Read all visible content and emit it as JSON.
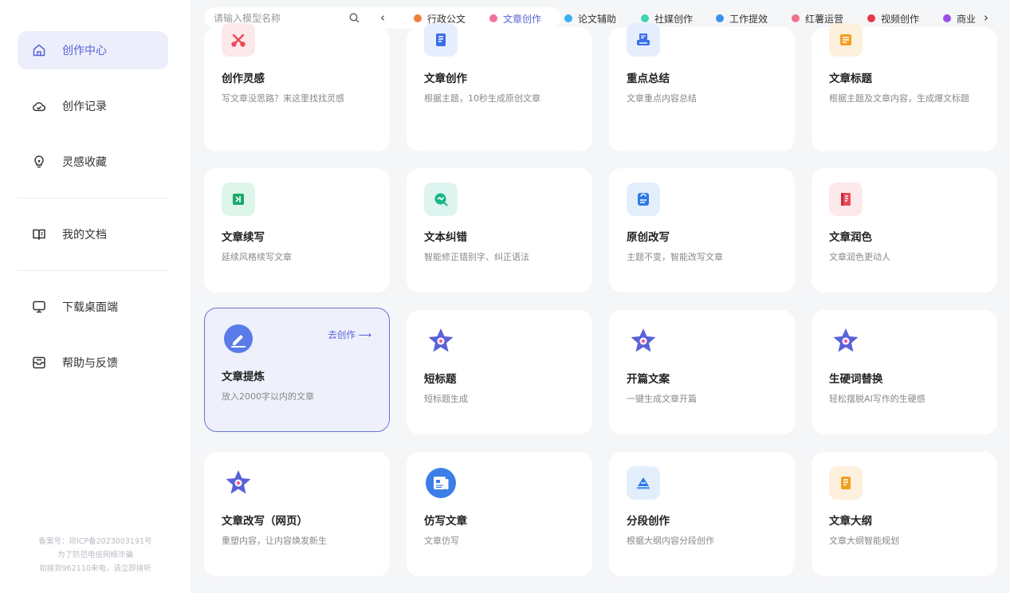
{
  "sidebar": {
    "items": [
      {
        "label": "创作中心",
        "icon": "home-icon",
        "active": true
      },
      {
        "label": "创作记录",
        "icon": "cloud-icon"
      },
      {
        "label": "灵感收藏",
        "icon": "lightbulb-icon"
      },
      {
        "label": "我的文档",
        "icon": "book-icon"
      },
      {
        "label": "下载桌面端",
        "icon": "monitor-icon"
      },
      {
        "label": "帮助与反馈",
        "icon": "mailbox-icon"
      }
    ],
    "footer": {
      "line1": "备案号：琼ICP备2023003191号",
      "line2": "为了防范电信网络诈骗",
      "line3": "如接到962110来电，请立即接听"
    }
  },
  "search": {
    "placeholder": "请输入模型名称"
  },
  "categories": [
    {
      "label": "行政公文",
      "color": "#f07f3c"
    },
    {
      "label": "文章创作",
      "color": "#f0719a",
      "active": true
    },
    {
      "label": "论文辅助",
      "color": "#3ab0ef"
    },
    {
      "label": "社媒创作",
      "color": "#3fd3b0"
    },
    {
      "label": "工作提效",
      "color": "#3d8ef0"
    },
    {
      "label": "红薯运营",
      "color": "#f0718a"
    },
    {
      "label": "视频创作",
      "color": "#e8374a"
    },
    {
      "label": "商业",
      "color": "#9a4ee8"
    }
  ],
  "goto_label": "去创作 ⟶",
  "cards": [
    {
      "title": "创作灵感",
      "desc": "写文章没思路？来这里找找灵感",
      "icon": "scissors-icon",
      "bg": "#fde8ea",
      "fg": "#e94a5a"
    },
    {
      "title": "文章创作",
      "desc": "根据主题，10秒生成原创文章",
      "icon": "document-icon",
      "bg": "#e6eefd",
      "fg": "#3b6ee8"
    },
    {
      "title": "重点总结",
      "desc": "文章重点内容总结",
      "icon": "printer-icon",
      "bg": "#e6eefd",
      "fg": "#3b6ee8"
    },
    {
      "title": "文章标题",
      "desc": "根据主题及文章内容，生成爆文标题",
      "icon": "title-card-icon",
      "bg": "#fdf0dd",
      "fg": "#f0a020"
    },
    {
      "title": "文章续写",
      "desc": "延续风格续写文章",
      "icon": "continue-book-icon",
      "bg": "#def5ea",
      "fg": "#1aa86a"
    },
    {
      "title": "文本纠错",
      "desc": "智能修正错别字、纠正语法",
      "icon": "check-search-icon",
      "bg": "#def5ef",
      "fg": "#1ab48a"
    },
    {
      "title": "原创改写",
      "desc": "主题不变，智能改写文章",
      "icon": "rewrite-doc-icon",
      "bg": "#e3eefd",
      "fg": "#2d7ae8"
    },
    {
      "title": "文章润色",
      "desc": "文章润色更动人",
      "icon": "polish-book-icon",
      "bg": "#fde8ea",
      "fg": "#e94a5a"
    },
    {
      "title": "文章提炼",
      "desc": "放入2000字以内的文章",
      "icon": "edit-circle-icon",
      "bg": "#5a7be8",
      "fg": "#ffffff",
      "highlight": true
    },
    {
      "title": "短标题",
      "desc": "短标题生成",
      "icon": "star-icon",
      "bg": "transparent",
      "fg": "#5a62d8"
    },
    {
      "title": "开篇文案",
      "desc": "一键生成文章开篇",
      "icon": "star-icon",
      "bg": "transparent",
      "fg": "#5a62d8"
    },
    {
      "title": "生硬词替换",
      "desc": "轻松摆脱AI写作的生硬感",
      "icon": "star-icon",
      "bg": "transparent",
      "fg": "#5a62d8"
    },
    {
      "title": "文章改写（网页）",
      "desc": "重塑内容，让内容焕发新生",
      "icon": "star-icon",
      "bg": "transparent",
      "fg": "#5a62d8"
    },
    {
      "title": "仿写文章",
      "desc": "文章仿写",
      "icon": "newspaper-circle-icon",
      "bg": "#3b7ee8",
      "fg": "#ffffff"
    },
    {
      "title": "分段创作",
      "desc": "根据大纲内容分段创作",
      "icon": "segment-icon",
      "bg": "#e3eefd",
      "fg": "#2d7ae8"
    },
    {
      "title": "文章大纲",
      "desc": "文章大纲智能规划",
      "icon": "outline-doc-icon",
      "bg": "#fdf0dd",
      "fg": "#f0a020"
    }
  ]
}
